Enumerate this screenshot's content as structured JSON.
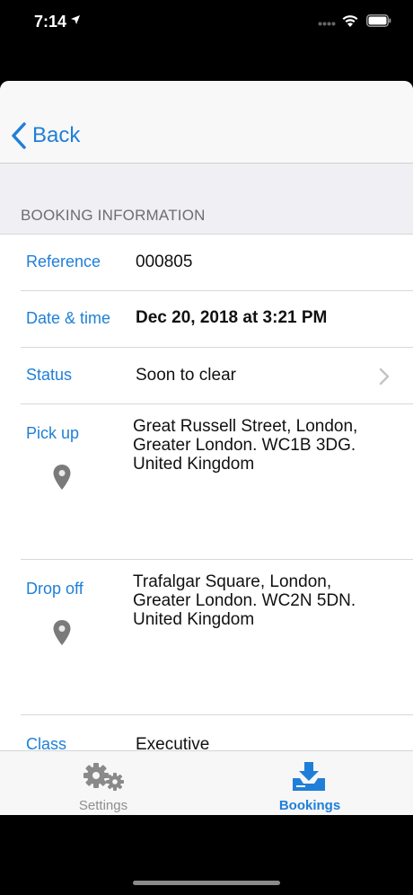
{
  "status_bar": {
    "time": "7:14"
  },
  "nav": {
    "back_label": "Back"
  },
  "section": {
    "header": "BOOKING INFORMATION"
  },
  "booking": {
    "reference": {
      "label": "Reference",
      "value": "000805"
    },
    "date_time": {
      "label": "Date & time",
      "value": "Dec 20, 2018 at 3:21 PM"
    },
    "status": {
      "label": "Status",
      "value": "Soon to clear"
    },
    "pick_up": {
      "label": "Pick up",
      "lines": [
        "Great Russell Street, London,",
        "Greater London. WC1B 3DG.",
        "United Kingdom"
      ]
    },
    "drop_off": {
      "label": "Drop off",
      "lines": [
        "Trafalgar Square, London,",
        "Greater London. WC2N 5DN.",
        "United Kingdom"
      ]
    },
    "class": {
      "label": "Class",
      "value": "Executive"
    }
  },
  "tab_bar": {
    "settings_label": "Settings",
    "bookings_label": "Bookings",
    "active": "Bookings"
  },
  "colors": {
    "accent": "#1f7fd8",
    "label_gray": "#6d6d72",
    "inactive_tab": "#8e8e8e"
  }
}
